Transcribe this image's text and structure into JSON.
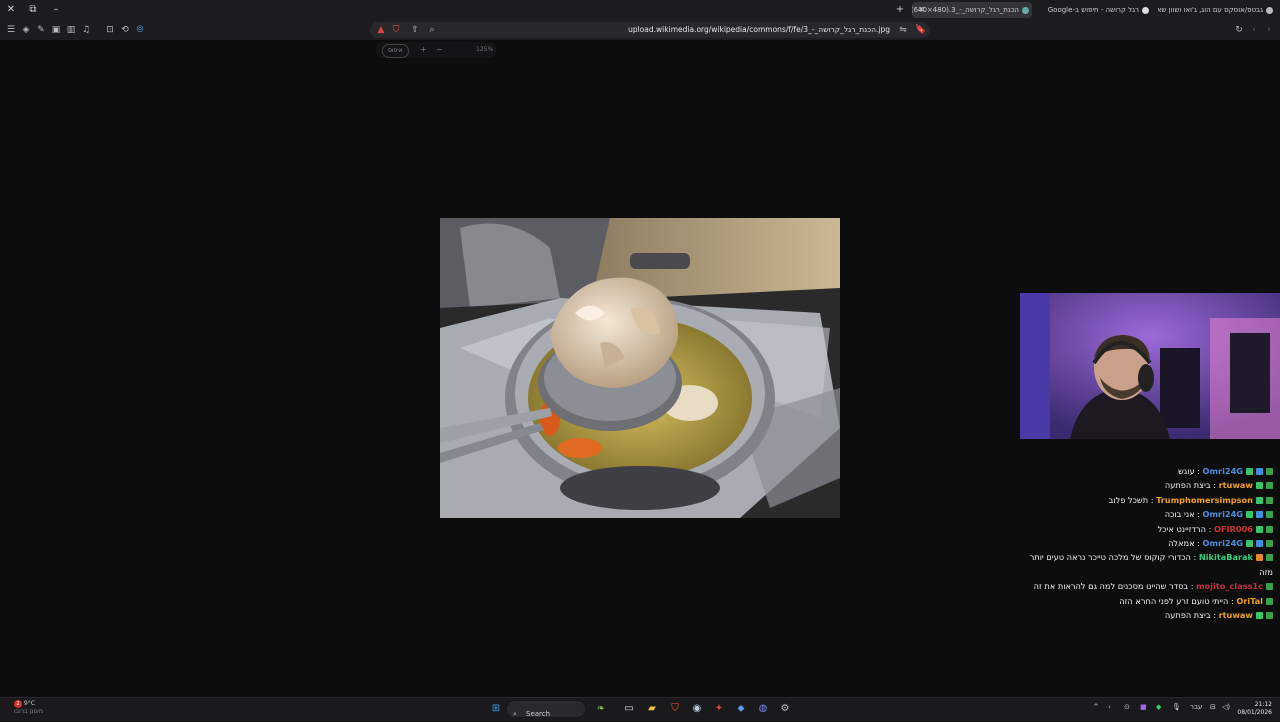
{
  "browser": {
    "tabs": [
      {
        "title": "גבטפ/אוסקס עם הוג, ג'ואו ושוון שאלוש…",
        "active": false
      },
      {
        "title": "רגל קרושה - חיפוש ב-Google",
        "active": false
      },
      {
        "title": "הכנת_רגל_קרושה_-_3.jpg (640×480)",
        "active": true
      }
    ],
    "new_tab": "+",
    "url": "upload.wikimedia.org/wikipedia/commons/f/fe/3_-_הכנת_רגל_קרושה.jpg",
    "zoom": {
      "reset_label": "איפוס",
      "plus": "+",
      "minus": "−",
      "level": "125%"
    }
  },
  "webcam_label": "",
  "chat": [
    {
      "user": "Omri24G",
      "color": "#4a8fe0",
      "badges": [
        "#3aa04a",
        "#3a8fe0",
        "#35c56a"
      ],
      "text": "עוגש"
    },
    {
      "user": "rtuwaw",
      "color": "#f0a020",
      "badges": [
        "#3aa04a",
        "#35c56a"
      ],
      "text": "ביצת הפתעה"
    },
    {
      "user": "Trumphomersimpson",
      "color": "#f0a020",
      "badges": [
        "#3aa04a",
        "#35c56a"
      ],
      "text": "תשכל פלוב"
    },
    {
      "user": "Omri24G",
      "color": "#4a8fe0",
      "badges": [
        "#3aa04a",
        "#3a8fe0",
        "#35c56a"
      ],
      "text": "אני בוכה"
    },
    {
      "user": "OFIR006",
      "color": "#d03030",
      "badges": [
        "#3aa04a",
        "#35c56a"
      ],
      "text": "הרדזיינט איכל"
    },
    {
      "user": "Omri24G",
      "color": "#4a8fe0",
      "badges": [
        "#3aa04a",
        "#3a8fe0",
        "#35c56a"
      ],
      "text": "אמאלה"
    },
    {
      "user": "NikitaBarak",
      "color": "#2fd07a",
      "badges": [
        "#3aa04a",
        "#e08a20"
      ],
      "text": "הכדורי קוקוס של מלכה טייכר נראה טעים יותר מזה"
    },
    {
      "user": "mojito_class1c",
      "color": "#c03040",
      "badges": [
        "#3aa04a"
      ],
      "text": "בסדר שהיינו מסכנים למה גם להראות את זה"
    },
    {
      "user": "OriTal",
      "color": "#f0a020",
      "badges": [
        "#3aa04a"
      ],
      "text": "הייתי טועם זרע לפני החרא הזה"
    },
    {
      "user": "rtuwaw",
      "color": "#f0a020",
      "badges": [
        "#3aa04a",
        "#35c56a"
      ],
      "text": "ביצת הפתעה"
    }
  ],
  "taskbar": {
    "search_label": "Search",
    "weather_temp": "9°C",
    "weather_desc": "מעונן ברובו",
    "lang": "עבר",
    "time": "21:12",
    "date": "08/01/2026",
    "notif_count": "2"
  }
}
